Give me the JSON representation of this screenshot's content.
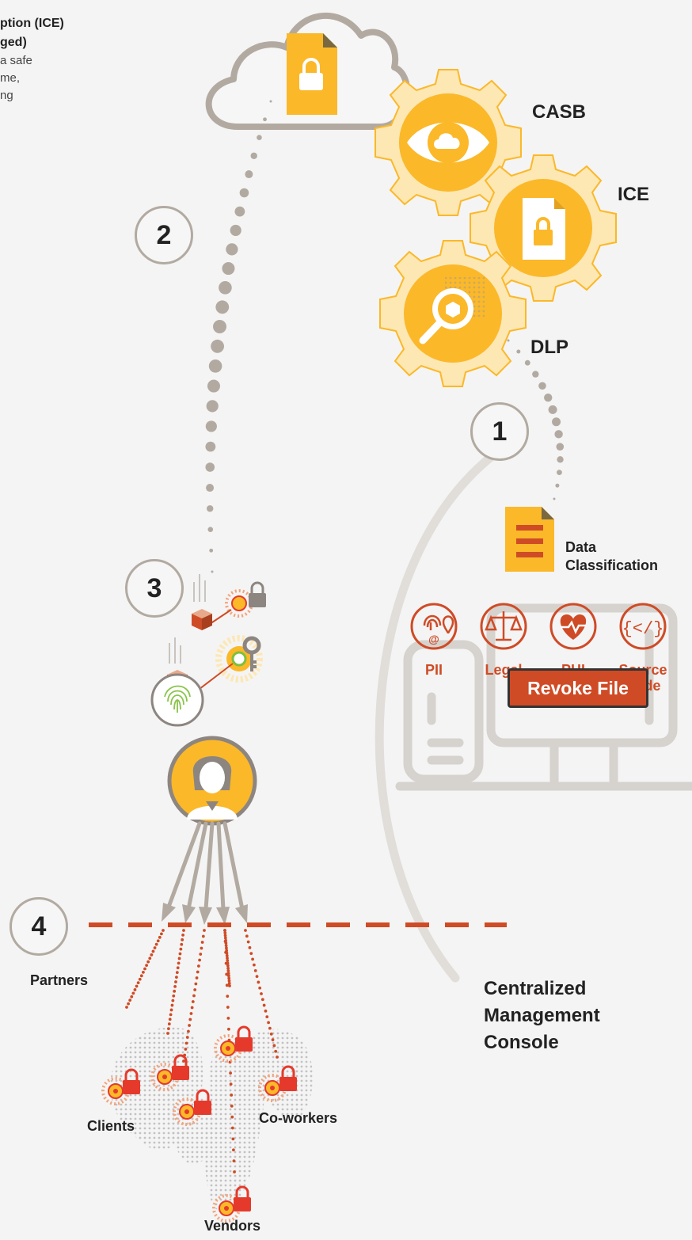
{
  "intro": {
    "line1": "ption (ICE)",
    "line2": "ged)",
    "line3": "a safe",
    "line4": "me,",
    "line5": "ng"
  },
  "gears": [
    "CASB",
    "ICE",
    "DLP"
  ],
  "steps": [
    "1",
    "2",
    "3",
    "4"
  ],
  "data_classification": [
    "Data",
    "Classification"
  ],
  "classification_types": [
    {
      "label": "PII",
      "icon": "fingerprint-location-icon"
    },
    {
      "label": "Legal",
      "icon": "scales-icon"
    },
    {
      "label": "PHI",
      "icon": "heart-pulse-icon"
    },
    {
      "label": "Source",
      "label2": "Code",
      "icon": "code-braces-icon"
    }
  ],
  "revoke_button": "Revoke File",
  "console_lines": [
    "Centralized",
    "Management",
    "Console"
  ],
  "regions": [
    "Partners",
    "Clients",
    "Co-workers",
    "Vendors"
  ],
  "colors": {
    "accent": "#fbb829",
    "orange": "#cf4b26",
    "red": "#e53a2b",
    "gray": "#b2aaa1"
  }
}
